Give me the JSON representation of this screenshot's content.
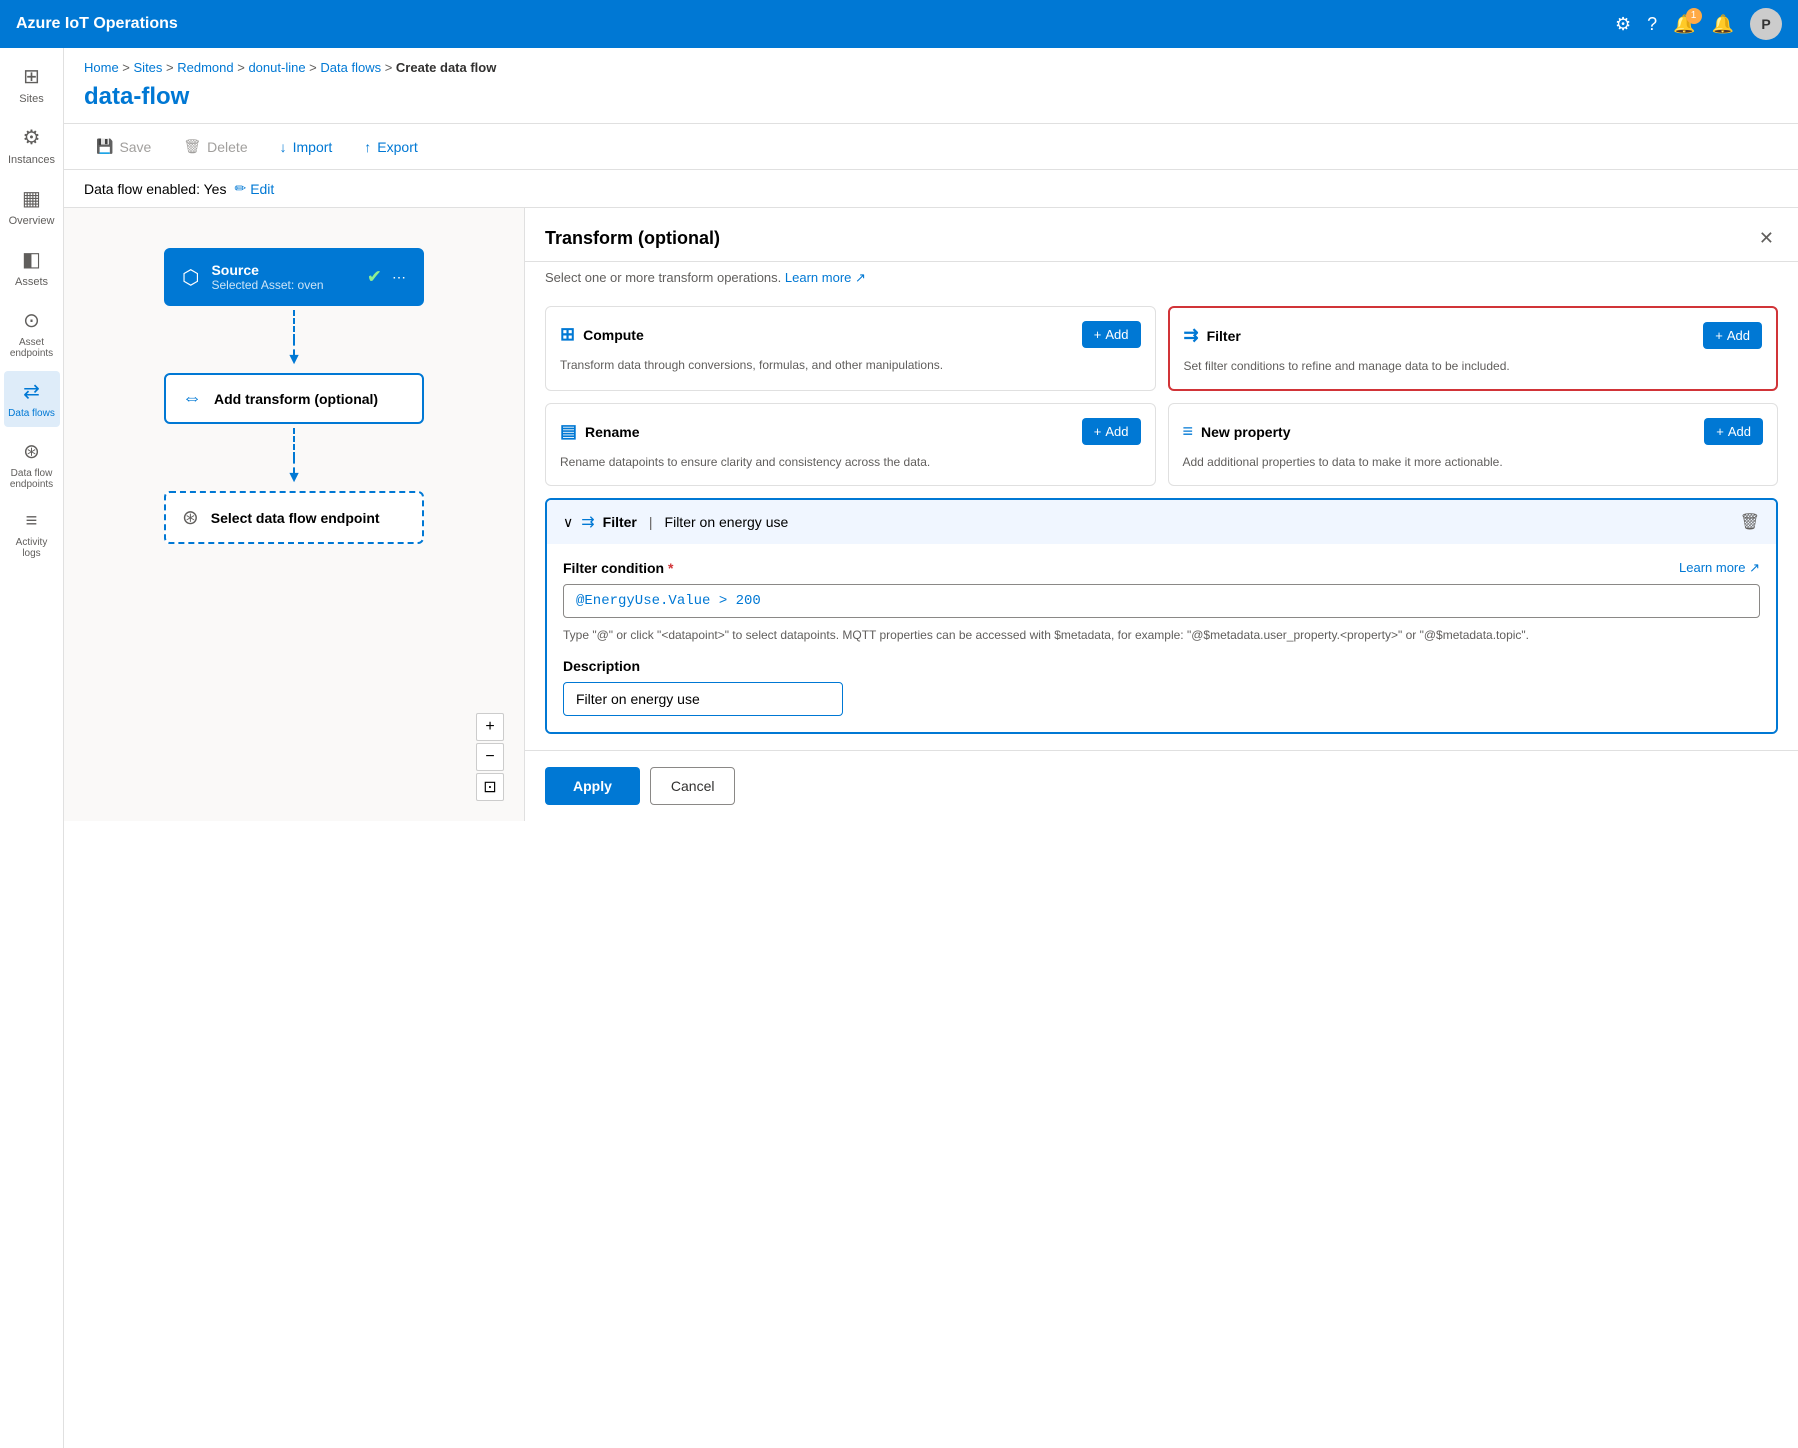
{
  "app": {
    "title": "Azure IoT Operations"
  },
  "topnav": {
    "title": "Azure IoT Operations",
    "notification_count": "1",
    "avatar_label": "P"
  },
  "breadcrumb": {
    "items": [
      "Home",
      "Sites",
      "Redmond",
      "donut-line",
      "Data flows",
      "Create data flow"
    ],
    "separator": " > "
  },
  "page": {
    "title": "data-flow"
  },
  "toolbar": {
    "save_label": "Save",
    "delete_label": "Delete",
    "import_label": "Import",
    "export_label": "Export"
  },
  "status_bar": {
    "label": "Data flow enabled: Yes",
    "edit_label": "Edit"
  },
  "sidebar": {
    "items": [
      {
        "id": "sites",
        "label": "Sites",
        "icon": "⊞"
      },
      {
        "id": "instances",
        "label": "Instances",
        "icon": "⚙"
      },
      {
        "id": "overview",
        "label": "Overview",
        "icon": "▦"
      },
      {
        "id": "assets",
        "label": "Assets",
        "icon": "◧"
      },
      {
        "id": "asset-endpoints",
        "label": "Asset endpoints",
        "icon": "⊙"
      },
      {
        "id": "data-flows",
        "label": "Data flows",
        "icon": "⇄"
      },
      {
        "id": "data-flow-endpoints",
        "label": "Data flow endpoints",
        "icon": "⊛"
      },
      {
        "id": "activity-logs",
        "label": "Activity logs",
        "icon": "≡"
      }
    ]
  },
  "canvas": {
    "nodes": [
      {
        "id": "source",
        "type": "source",
        "title": "Source",
        "subtitle": "Selected Asset: oven",
        "icon": "⬡",
        "has_check": true
      },
      {
        "id": "transform",
        "type": "transform",
        "title": "Add transform (optional)",
        "icon": "⇔"
      },
      {
        "id": "endpoint",
        "type": "endpoint",
        "title": "Select data flow endpoint",
        "icon": "⊛"
      }
    ],
    "controls": {
      "zoom_in": "+",
      "zoom_out": "−",
      "fit": "⊡"
    }
  },
  "panel": {
    "title": "Transform (optional)",
    "subtitle": "Select one or more transform operations.",
    "learn_more_label": "Learn more",
    "cards": [
      {
        "id": "compute",
        "title": "Compute",
        "icon": "⊞",
        "description": "Transform data through conversions, formulas, and other manipulations.",
        "add_label": "+ Add",
        "highlighted": false
      },
      {
        "id": "filter",
        "title": "Filter",
        "icon": "⇉",
        "description": "Set filter conditions to refine and manage data to be included.",
        "add_label": "+ Add",
        "highlighted": true
      },
      {
        "id": "rename",
        "title": "Rename",
        "icon": "▤",
        "description": "Rename datapoints to ensure clarity and consistency across the data.",
        "add_label": "+ Add",
        "highlighted": false
      },
      {
        "id": "new-property",
        "title": "New property",
        "icon": "≡",
        "description": "Add additional properties to data to make it more actionable.",
        "add_label": "+ Add",
        "highlighted": false
      }
    ],
    "filter_section": {
      "title": "Filter",
      "divider": "|",
      "name": "Filter on energy use",
      "condition_label": "Filter condition",
      "required": "*",
      "learn_more": "Learn more",
      "condition_value": "@EnergyUse.Value > 200",
      "hint": "Type \"@\" or click \"<datapoint>\" to select datapoints. MQTT properties can be accessed with $metadata, for example: \"@$metadata.user_property.<property>\" or \"@$metadata.topic\".",
      "description_label": "Description",
      "description_value": "Filter on energy use"
    },
    "footer": {
      "apply_label": "Apply",
      "cancel_label": "Cancel"
    }
  }
}
